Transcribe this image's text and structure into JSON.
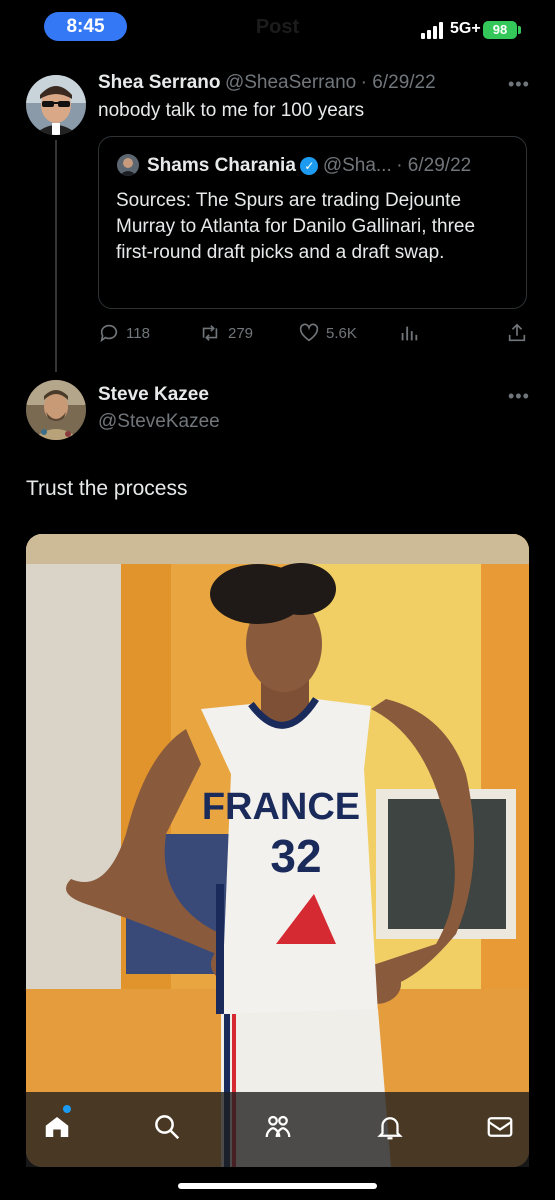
{
  "status_bar": {
    "time": "8:45",
    "header_title": "Post",
    "network": "5G+",
    "battery": "98"
  },
  "tweet1": {
    "name": "Shea Serrano",
    "handle": "@SheaSerrano",
    "date": "· 6/29/22",
    "text": "nobody talk to me for 100 years",
    "quote": {
      "name": "Shams Charania",
      "handle": "@Sha...",
      "date": "· 6/29/22",
      "text": "Sources: The Spurs are trading Dejounte Murray to Atlanta for Danilo Gallinari, three first-round draft picks and a draft swap."
    },
    "replies": "118",
    "retweets": "279",
    "likes": "5.6K"
  },
  "tweet2": {
    "name": "Steve Kazee",
    "handle": "@SteveKazee",
    "text": "Trust the process",
    "image": {
      "jersey_text": "FRANCE",
      "jersey_number": "32"
    }
  },
  "tabbar": {
    "items": [
      "home-icon",
      "search-icon",
      "communities-icon",
      "notifications-icon",
      "messages-icon"
    ]
  },
  "colors": {
    "accent": "#1d9bf0",
    "time_pill": "#3478f6",
    "battery": "#34c759"
  }
}
